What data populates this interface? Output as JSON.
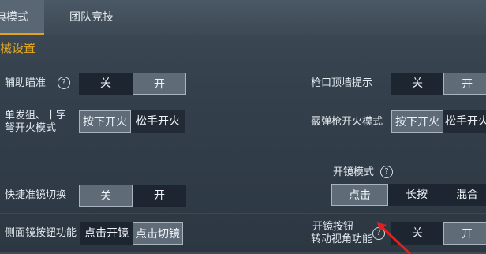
{
  "tabs": {
    "classic": "典模式",
    "team": "团队竞技"
  },
  "section_title": "械设置",
  "rows": {
    "aim_assist": {
      "label": "辅助瞄准",
      "off": "关",
      "on": "开"
    },
    "wall_hint": {
      "label": "枪口顶墙提示",
      "off": "关",
      "on": "开"
    },
    "single_sniper": {
      "label_line1": "单发狙、十字",
      "label_line2": "弩开火模式",
      "opt1": "按下开火",
      "opt2": "松手开火"
    },
    "shotgun_fire": {
      "label": "霰弹枪开火模式",
      "opt1": "按下开火",
      "opt2": "松手开火"
    },
    "quick_scope": {
      "label": "快捷准镜切换",
      "off": "关",
      "on": "开"
    },
    "scope_mode": {
      "label": "开镜模式",
      "opt1": "点击",
      "opt2": "长按",
      "opt3": "混合"
    },
    "side_scope": {
      "label": "侧面镜按钮功能",
      "opt1": "点击开镜",
      "opt2": "点击切镜"
    },
    "scope_turn": {
      "label_line1": "开镜按钮",
      "label_line2": "转动视角功能",
      "off": "关",
      "on": "开"
    }
  },
  "info_glyph": "?",
  "accent_color": "#e6a922",
  "arrow_color": "#e0211f"
}
